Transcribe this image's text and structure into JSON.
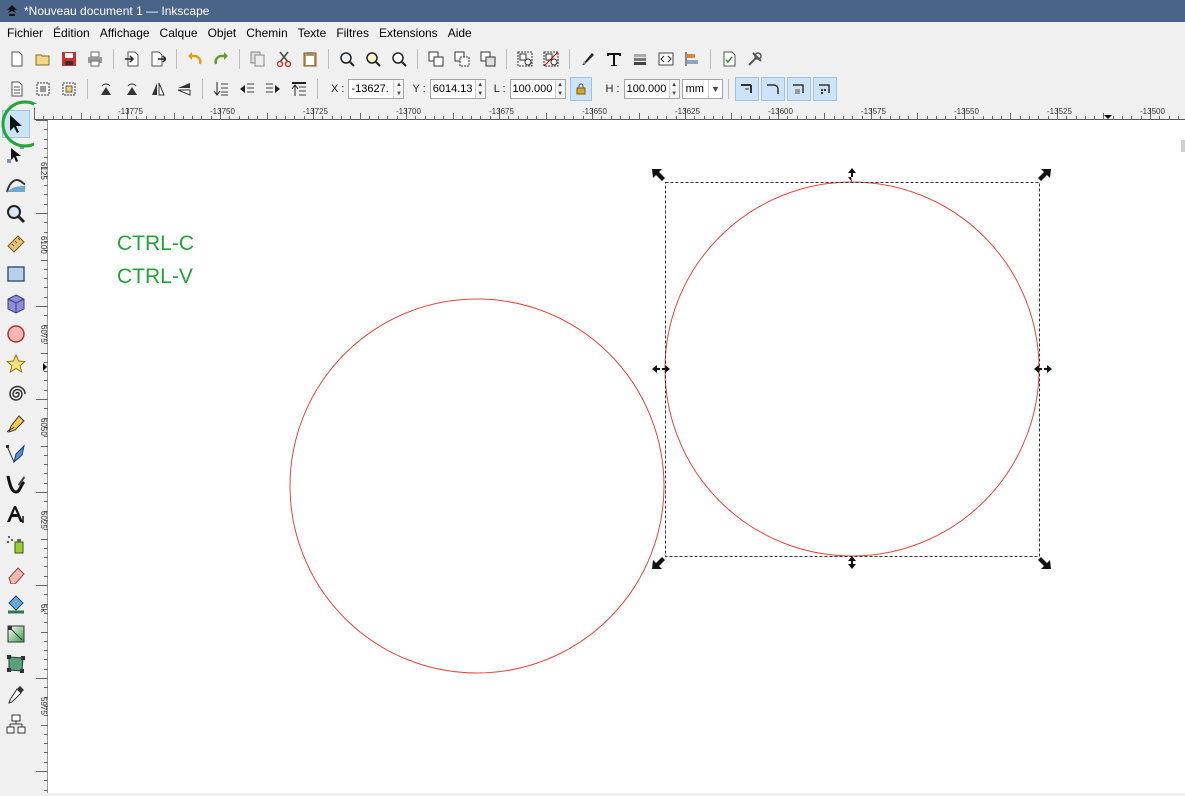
{
  "window": {
    "title": "*Nouveau document 1 — Inkscape"
  },
  "menu": [
    "Fichier",
    "Édition",
    "Affichage",
    "Calque",
    "Objet",
    "Chemin",
    "Texte",
    "Filtres",
    "Extensions",
    "Aide"
  ],
  "commands_bar": {
    "icons": [
      "new-icon",
      "open-icon",
      "save-icon",
      "print-icon",
      "import-icon",
      "export-icon",
      "undo-icon",
      "redo-icon",
      "copy-icon",
      "cut-icon",
      "paste-icon",
      "zoom-selection-icon",
      "zoom-drawing-icon",
      "zoom-page-icon",
      "duplicate-icon",
      "clone-icon",
      "unlink-clone-icon",
      "group-icon",
      "ungroup-icon",
      "fill-stroke-icon",
      "text-font-icon",
      "layers-icon",
      "xml-editor-icon",
      "align-distribute-icon",
      "document-properties-icon",
      "preferences-icon"
    ]
  },
  "select_toolbar": {
    "x_label": "X :",
    "x_value": "-13627.",
    "y_label": "Y :",
    "y_value": "6014.13",
    "w_label": "L :",
    "w_value": "100.000",
    "h_label": "H :",
    "h_value": "100.000",
    "unit": "mm",
    "lock_state": "locked"
  },
  "tools": [
    "selector-icon",
    "node-icon",
    "tweak-icon",
    "zoom-icon",
    "measure-icon",
    "rectangle-icon",
    "3dbox-icon",
    "ellipse-icon",
    "star-icon",
    "spiral-icon",
    "pencil-icon",
    "pen-icon",
    "calligraphy-icon",
    "text-icon",
    "spray-icon",
    "eraser-icon",
    "paint-bucket-icon",
    "gradient-icon",
    "mesh-icon",
    "dropper-icon",
    "connector-icon"
  ],
  "ruler": {
    "h_labels": [
      "-13775",
      "-13750",
      "-13725",
      "-13700",
      "-13675",
      "-13650",
      "-13625",
      "-13600",
      "-13575",
      "-13550",
      "-13525",
      "-13500"
    ],
    "v_labels": [
      "6125",
      "6100",
      "6075",
      "6050",
      "6025",
      "6k",
      "5975"
    ]
  },
  "canvas": {
    "note_line1": "CTRL-C",
    "note_line2": "CTRL-V",
    "note_color": "#21a338",
    "circle_stroke": "#e8463c",
    "highlight_color": "#22a638"
  }
}
